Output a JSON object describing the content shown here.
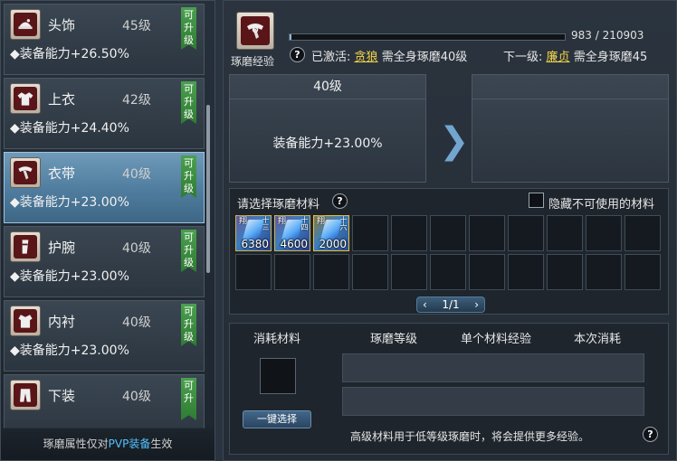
{
  "equipment_list": [
    {
      "name": "头饰",
      "level": "45级",
      "stat": "◆装备能力+26.50%",
      "badge": "可升级",
      "icon": "headgear-icon",
      "selected": false
    },
    {
      "name": "上衣",
      "level": "42级",
      "stat": "◆装备能力+24.40%",
      "badge": "可升级",
      "icon": "top-garment-icon",
      "selected": false
    },
    {
      "name": "衣带",
      "level": "40级",
      "stat": "◆装备能力+23.00%",
      "badge": "可升级",
      "icon": "belt-icon",
      "selected": true
    },
    {
      "name": "护腕",
      "level": "40级",
      "stat": "◆装备能力+23.00%",
      "badge": "可升级",
      "icon": "bracer-icon",
      "selected": false
    },
    {
      "name": "内衬",
      "level": "40级",
      "stat": "◆装备能力+23.00%",
      "badge": "可升级",
      "icon": "inner-lining-icon",
      "selected": false
    },
    {
      "name": "下装",
      "level": "40级",
      "stat": "",
      "badge": "可升",
      "icon": "pants-icon",
      "selected": false
    }
  ],
  "footer": {
    "prefix": "琢磨属性仅对",
    "highlight": "PVP装备",
    "suffix": "生效"
  },
  "header": {
    "exp_label": "琢磨经验",
    "exp_current": 983,
    "exp_max": 210903,
    "exp_text": "983 / 210903",
    "activated_label": "已激活:",
    "activated_name": "贪狼",
    "activated_req": "需全身琢磨40级",
    "next_label": "下一级:",
    "next_name": "廉贞",
    "next_req": "需全身琢磨45"
  },
  "current_level": {
    "title": "40级",
    "stat": "装备能力+23.00%"
  },
  "next_level": {
    "title": "",
    "stat": ""
  },
  "materials": {
    "title": "请选择琢磨材料",
    "hide_unusable": "隐藏不可使用的材料",
    "items": [
      {
        "tag": "翔",
        "tier": "十三",
        "count": "6380"
      },
      {
        "tag": "翔",
        "tier": "十四",
        "count": "4600"
      },
      {
        "tag": "翔",
        "tier": "十六",
        "count": "2000"
      }
    ],
    "page": "1/1",
    "prev": "‹",
    "next": "›"
  },
  "consume": {
    "col1": "消耗材料",
    "col2": "琢磨等级",
    "col3": "单个材料经验",
    "col4": "本次消耗",
    "one_click": "一键选择",
    "note": "高级材料用于低等级琢磨时，将会提供更多经验。"
  },
  "colors": {
    "highlight_blue": "#52c3ff",
    "accent_yellow": "#f3d54a",
    "badge_green": "#3a8f3e",
    "selected_blue": "#4f7c9e"
  }
}
